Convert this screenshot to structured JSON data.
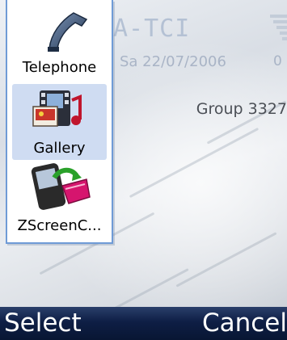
{
  "idle": {
    "operator": "A-TCI",
    "date": "Sa 22/07/2006",
    "clock_fragment": "0",
    "group": "Group 3327"
  },
  "popup": {
    "items": [
      {
        "label": "Telephone",
        "icon": "telephone-icon",
        "selected": false
      },
      {
        "label": "Gallery",
        "icon": "gallery-icon",
        "selected": true
      },
      {
        "label": "ZScreenC...",
        "icon": "zscreencapture-icon",
        "selected": false
      }
    ]
  },
  "softkeys": {
    "left": "Select",
    "right": "Cancel"
  },
  "colors": {
    "selection": "#cfdcf2",
    "popup_border": "#6f9bd6",
    "softkey_bar": "#0e1e45"
  }
}
